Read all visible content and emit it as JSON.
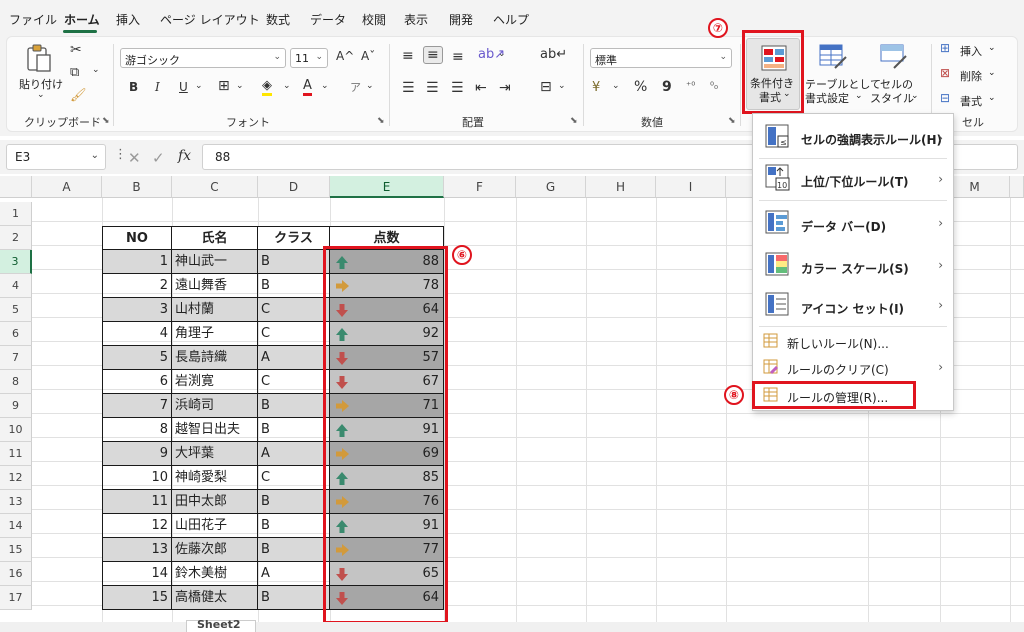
{
  "menu": {
    "items": [
      "ファイル",
      "ホーム",
      "挿入",
      "ページ レイアウト",
      "数式",
      "データ",
      "校閲",
      "表示",
      "開発",
      "ヘルプ"
    ],
    "active": "ホーム"
  },
  "ribbon": {
    "clipboard": {
      "paste_label": "貼り付け",
      "group_label": "クリップボード"
    },
    "font": {
      "font_name": "游ゴシック",
      "font_size": "11",
      "grow": "A^",
      "shrink": "Aˇ",
      "bold": "B",
      "italic": "I",
      "underline": "U",
      "group_label": "フォント"
    },
    "alignment": {
      "group_label": "配置"
    },
    "number": {
      "format": "標準",
      "percent": "%",
      "comma": "9",
      "group_label": "数値"
    },
    "styles": {
      "conditional_formatting": "条件付き書式",
      "conditional_formatting_line1": "条件付き",
      "conditional_formatting_line2": "書式",
      "table_line1": "テーブルとして",
      "table_line2": "書式設定",
      "cell_style_line1": "セルの",
      "cell_style_line2": "スタイル"
    },
    "cells": {
      "insert": "挿入",
      "delete": "削除",
      "format": "書式",
      "group_label": "セル"
    }
  },
  "formula_bar": {
    "name_box": "E3",
    "fx": "fx",
    "value": "88"
  },
  "columns": [
    "A",
    "B",
    "C",
    "D",
    "E",
    "F",
    "G",
    "H",
    "I",
    "M"
  ],
  "rows": [
    "1",
    "2",
    "3",
    "4",
    "5",
    "6",
    "7",
    "8",
    "9",
    "10",
    "11",
    "12",
    "13",
    "14",
    "15",
    "16",
    "17"
  ],
  "table": {
    "headers": [
      "NO",
      "氏名",
      "クラス",
      "点数"
    ],
    "rows": [
      {
        "no": "1",
        "name": "神山武一",
        "cls": "B",
        "score": "88",
        "icon": "up"
      },
      {
        "no": "2",
        "name": "遠山舞香",
        "cls": "B",
        "score": "78",
        "icon": "right"
      },
      {
        "no": "3",
        "name": "山村蘭",
        "cls": "C",
        "score": "64",
        "icon": "down"
      },
      {
        "no": "4",
        "name": "角理子",
        "cls": "C",
        "score": "92",
        "icon": "up"
      },
      {
        "no": "5",
        "name": "長島詩織",
        "cls": "A",
        "score": "57",
        "icon": "down"
      },
      {
        "no": "6",
        "name": "岩渕寛",
        "cls": "C",
        "score": "67",
        "icon": "down"
      },
      {
        "no": "7",
        "name": "浜崎司",
        "cls": "B",
        "score": "71",
        "icon": "right"
      },
      {
        "no": "8",
        "name": "越智日出夫",
        "cls": "B",
        "score": "91",
        "icon": "up"
      },
      {
        "no": "9",
        "name": "大坪葉",
        "cls": "A",
        "score": "69",
        "icon": "right"
      },
      {
        "no": "10",
        "name": "神崎愛梨",
        "cls": "C",
        "score": "85",
        "icon": "up"
      },
      {
        "no": "11",
        "name": "田中太郎",
        "cls": "B",
        "score": "76",
        "icon": "right"
      },
      {
        "no": "12",
        "name": "山田花子",
        "cls": "B",
        "score": "91",
        "icon": "up"
      },
      {
        "no": "13",
        "name": "佐藤次郎",
        "cls": "B",
        "score": "77",
        "icon": "right"
      },
      {
        "no": "14",
        "name": "鈴木美樹",
        "cls": "A",
        "score": "65",
        "icon": "down"
      },
      {
        "no": "15",
        "name": "高橋健太",
        "cls": "B",
        "score": "64",
        "icon": "down"
      }
    ]
  },
  "dropdown": {
    "items": [
      {
        "label": "セルの強調表示ルール(H)",
        "submenu": true
      },
      {
        "label": "上位/下位ルール(T)",
        "submenu": true
      },
      {
        "label": "データ バー(D)",
        "submenu": true
      },
      {
        "label": "カラー スケール(S)",
        "submenu": true
      },
      {
        "label": "アイコン セット(I)",
        "submenu": true
      },
      {
        "label": "新しいルール(N)...",
        "submenu": false
      },
      {
        "label": "ルールのクリア(C)",
        "submenu": true
      },
      {
        "label": "ルールの管理(R)...",
        "submenu": false
      }
    ]
  },
  "annotations": {
    "six": "⑥",
    "seven": "⑦",
    "eight": "⑧"
  },
  "sheet_tabs": {
    "active": "Sheet2"
  },
  "colors": {
    "excel_green": "#1e7145",
    "highlight_red": "#e0141e",
    "arrow_up": "#3a8a6e",
    "arrow_right": "#d29a3b",
    "arrow_down": "#c0504d"
  }
}
